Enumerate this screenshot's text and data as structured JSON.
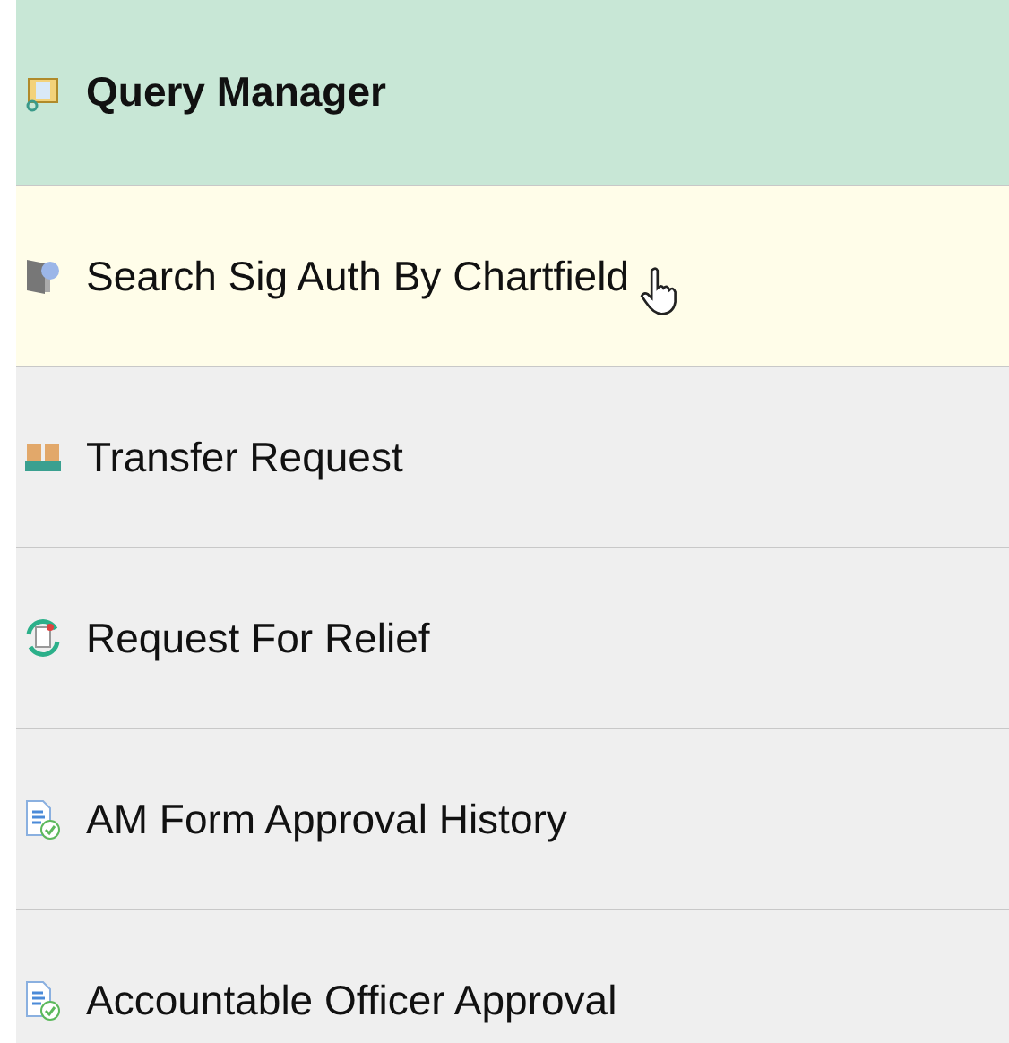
{
  "menu": {
    "items": [
      {
        "label": "Query Manager",
        "selected": true,
        "hovered": false
      },
      {
        "label": "Search Sig Auth By Chartfield",
        "selected": false,
        "hovered": true
      },
      {
        "label": "Transfer Request",
        "selected": false,
        "hovered": false
      },
      {
        "label": "Request For Relief",
        "selected": false,
        "hovered": false
      },
      {
        "label": "AM Form Approval History",
        "selected": false,
        "hovered": false
      },
      {
        "label": "Accountable Officer Approval",
        "selected": false,
        "hovered": false
      }
    ]
  }
}
